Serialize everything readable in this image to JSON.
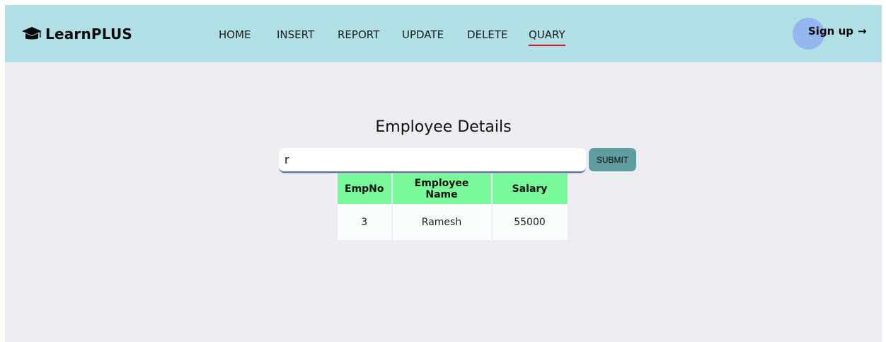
{
  "brand": {
    "name": "LearnPLUS",
    "icon": "graduation-cap-icon"
  },
  "nav": {
    "items": [
      {
        "label": "HOME",
        "active": false
      },
      {
        "label": "INSERT",
        "active": false
      },
      {
        "label": "REPORT",
        "active": false
      },
      {
        "label": "UPDATE",
        "active": false
      },
      {
        "label": "DELETE",
        "active": false
      },
      {
        "label": "QUARY",
        "active": true
      }
    ],
    "signup_label": "Sign up",
    "signup_arrow": "→"
  },
  "main": {
    "title": "Employee Details",
    "search": {
      "value": "r",
      "placeholder": ""
    },
    "submit_label": "SUBMIT",
    "table": {
      "headers": [
        "EmpNo",
        "Employee Name",
        "Salary"
      ],
      "rows": [
        [
          "3",
          "Ramesh",
          "55000"
        ]
      ]
    }
  },
  "colors": {
    "navbar": "#b0e0e6",
    "background": "#edecf0",
    "active_underline": "#e5142b",
    "table_header": "#78fa9a",
    "submit_button": "#5f9ea0",
    "signup_highlight": "#94b6ef"
  }
}
